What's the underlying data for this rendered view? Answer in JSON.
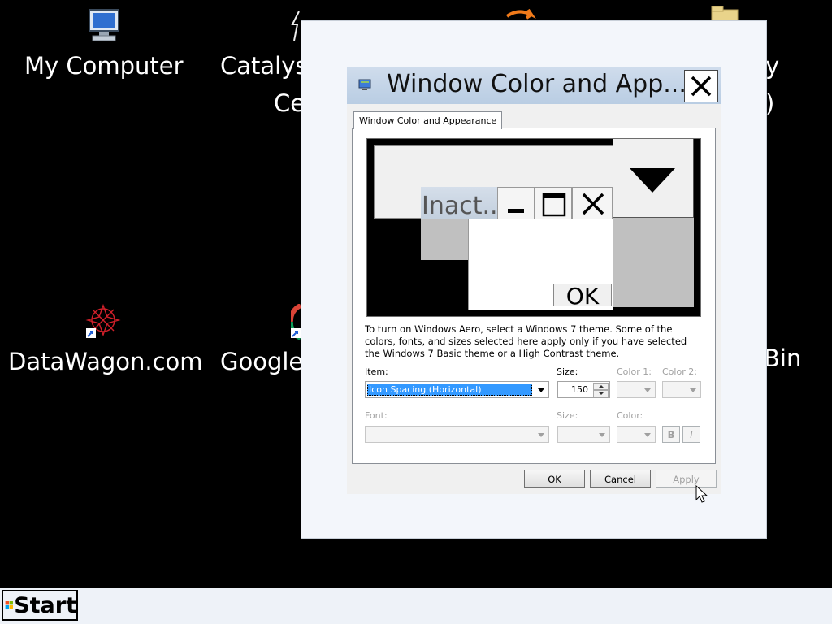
{
  "desktop": {
    "icons": [
      {
        "label": "My Computer",
        "icon": "computer-icon"
      },
      {
        "label": "Catalys",
        "icon": "catalyst-icon"
      },
      {
        "label": "Ce",
        "icon": "catalyst-icon"
      },
      {
        "label": "DataWagon.com",
        "icon": "datawagon-icon"
      },
      {
        "label": "Google",
        "icon": "google-chrome-icon"
      },
      {
        "label": "y",
        "icon": "folder-icon"
      },
      {
        "label": ")",
        "icon": "folder-icon"
      },
      {
        "label": "Bin",
        "icon": "recycle-bin-icon"
      }
    ]
  },
  "dialog": {
    "title": "Window Color and App...",
    "tab_label": "Window Color and Appearance",
    "preview": {
      "inactive_title": "Inact...",
      "ok_label": "OK"
    },
    "help_text": "To turn on Windows Aero, select a Windows 7 theme.  Some of the colors, fonts, and sizes selected here apply only if you have selected the Windows 7 Basic theme or a High Contrast theme.",
    "item_label": "Item:",
    "item_value": "Icon Spacing (Horizontal)",
    "size_label": "Size:",
    "size_value": "150",
    "color1_label": "Color 1:",
    "color2_label": "Color 2:",
    "font_label": "Font:",
    "font_size_label": "Size:",
    "font_color_label": "Color:",
    "bold_label": "B",
    "italic_label": "I",
    "ok_label": "OK",
    "cancel_label": "Cancel",
    "apply_label": "Apply"
  },
  "taskbar": {
    "start_label": "Start"
  },
  "colors": {
    "desktop": "#000000",
    "selection": "#3399ff",
    "title_bar": "#c4d4e8"
  }
}
